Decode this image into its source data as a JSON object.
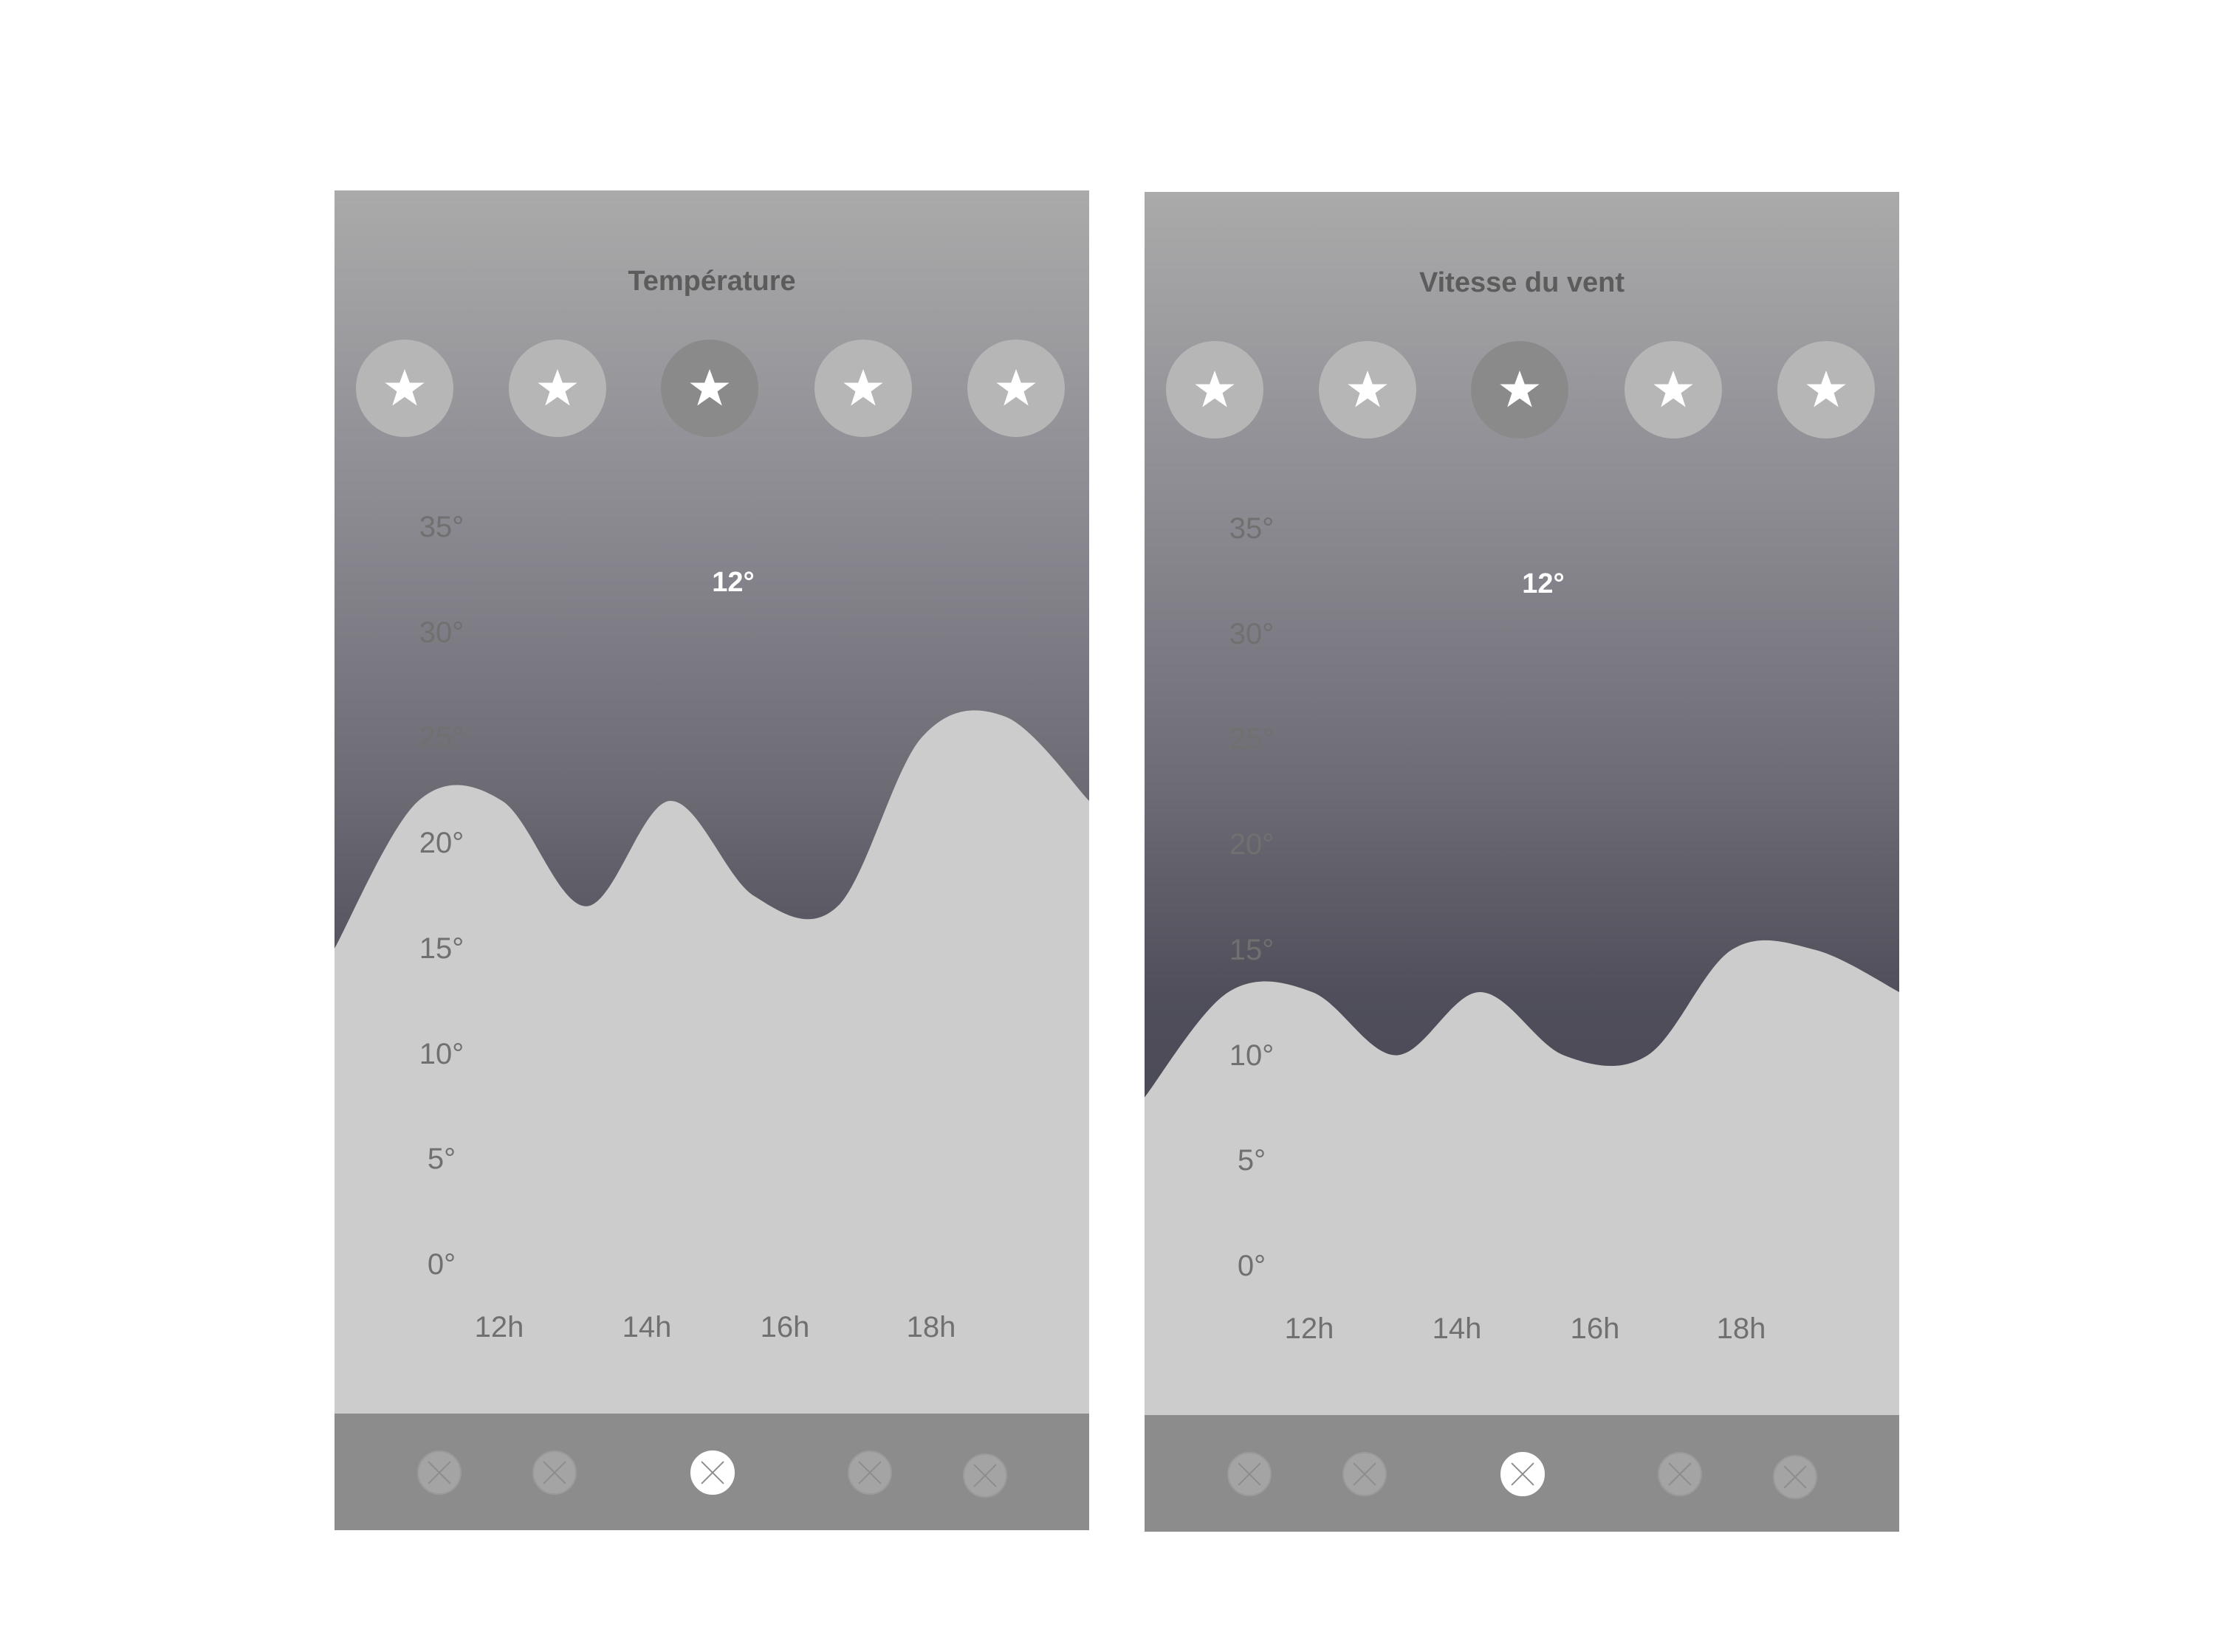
{
  "colors": {
    "gradient_top": "#aaaaaa",
    "gradient_bottom": "#3e3d4a",
    "curve_fill": "#cccccc",
    "nav_bar": "#8c8c8c",
    "favorite_circle": "#b6b6b6",
    "favorite_circle_active": "#8a8a8a"
  },
  "screens": [
    {
      "title": "Température",
      "current_value": "12°",
      "favorites": {
        "count": 5,
        "active_index": 2,
        "icon": "star-icon"
      },
      "y_axis_labels": [
        "35°",
        "30°",
        "25°",
        "20°",
        "15°",
        "10°",
        "5°",
        "0°"
      ],
      "x_axis_labels": [
        "12h",
        "14h",
        "16h",
        "18h"
      ],
      "nav": {
        "count": 5,
        "active_index": 2,
        "icon": "close-circle-icon"
      },
      "chart_data": {
        "type": "area",
        "x": [
          "11h",
          "12h",
          "13h",
          "14h",
          "15h",
          "16h",
          "17h",
          "18h",
          "19h",
          "20h"
        ],
        "values": [
          15,
          22,
          22,
          17,
          22,
          17.5,
          17,
          25,
          26,
          22
        ],
        "ylim": [
          0,
          35
        ]
      }
    },
    {
      "title": "Vitesse du vent",
      "current_value": "12°",
      "favorites": {
        "count": 5,
        "active_index": 2,
        "icon": "star-icon"
      },
      "y_axis_labels": [
        "35°",
        "30°",
        "25°",
        "20°",
        "15°",
        "10°",
        "5°",
        "0°"
      ],
      "x_axis_labels": [
        "12h",
        "14h",
        "16h",
        "18h"
      ],
      "nav": {
        "count": 5,
        "active_index": 2,
        "icon": "close-circle-icon"
      },
      "chart_data": {
        "type": "area",
        "x": [
          "11h",
          "12h",
          "13h",
          "14h",
          "15h",
          "16h",
          "17h",
          "18h",
          "19h",
          "20h"
        ],
        "values": [
          8,
          13,
          13,
          10,
          13,
          10,
          10,
          15,
          15,
          13
        ],
        "ylim": [
          0,
          35
        ]
      }
    }
  ]
}
